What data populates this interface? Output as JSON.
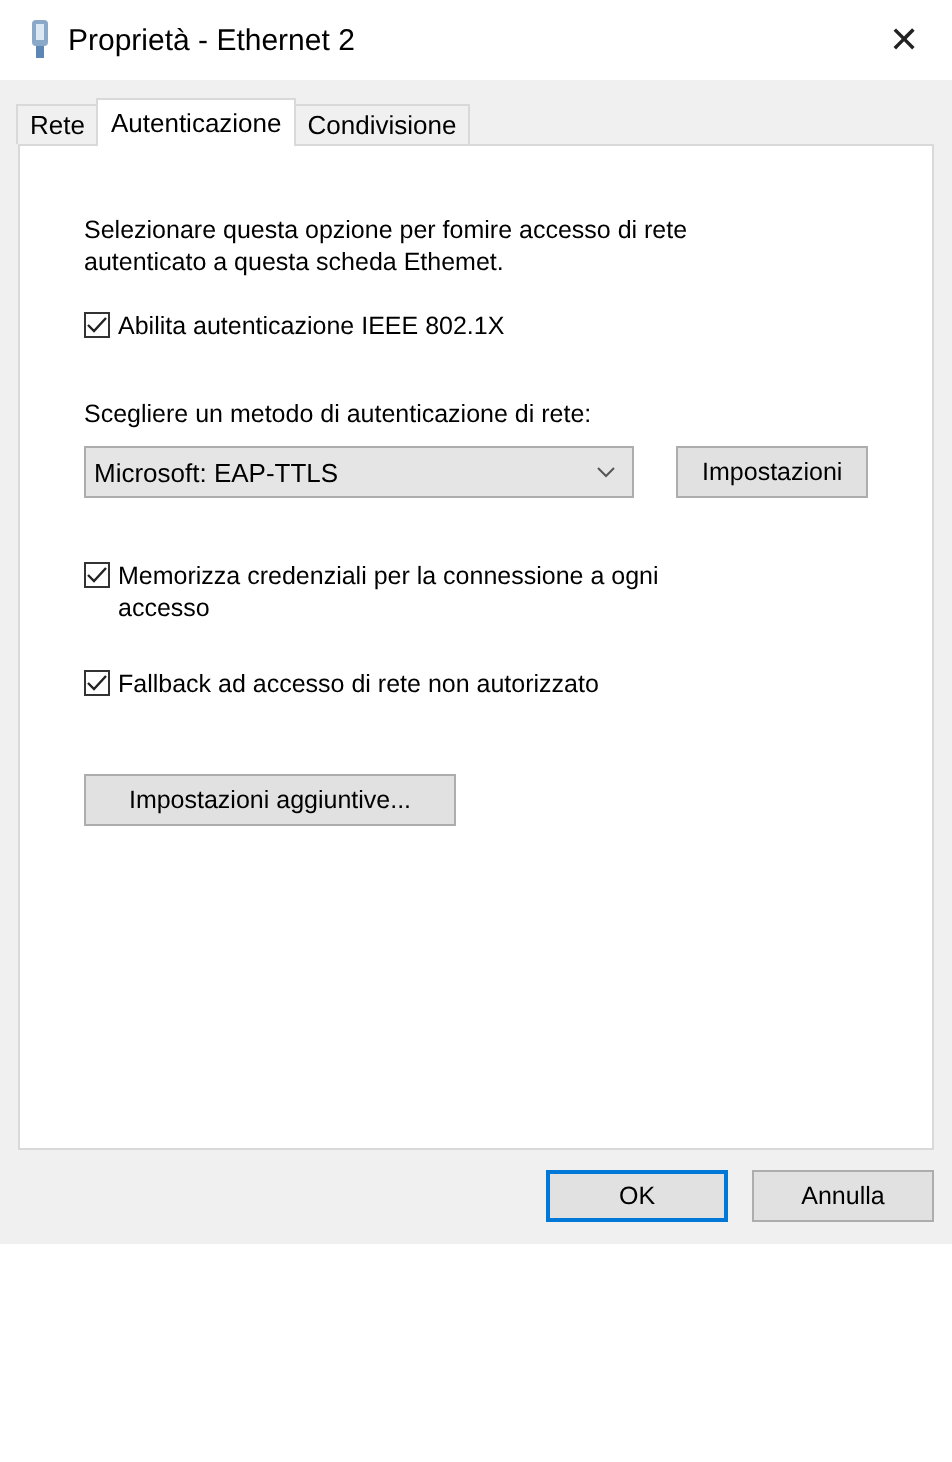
{
  "window": {
    "title": "Proprietà - Ethernet 2",
    "close": "✕"
  },
  "tabs": [
    {
      "label": "Rete",
      "selected": false
    },
    {
      "label": "Autenticazione",
      "selected": true
    },
    {
      "label": "Condivisione",
      "selected": false
    }
  ],
  "panel": {
    "description": "Selezionare questa opzione per fomire accesso di rete autenticato a questa scheda Ethemet.",
    "enable": {
      "label": "Abilita autenticazione IEEE 802.1X",
      "checked": true
    },
    "method_label": "Scegliere un metodo di autenticazione di rete:",
    "method": {
      "value": "Microsoft: EAP-TTLS"
    },
    "settings_button": "Impostazioni",
    "options": [
      {
        "label": "Memorizza credenziali per la connessione a ogni accesso",
        "checked": true
      },
      {
        "label": "Fallback ad accesso di rete non autorizzato",
        "checked": true
      }
    ],
    "more_button": "Impostazioni aggiuntive..."
  },
  "buttons": [
    {
      "label": "OK",
      "default": true
    },
    {
      "label": "Annulla",
      "default": false
    }
  ]
}
